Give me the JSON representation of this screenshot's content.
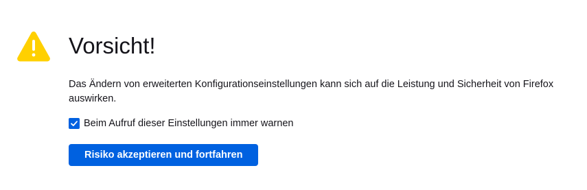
{
  "warning": {
    "icon": "warning-triangle-icon",
    "icon_color": "#ffd000",
    "title": "Vorsicht!",
    "description": "Das Ändern von erweiterten Konfigurationseinstellungen kann sich auf die Leistung und Sicherheit von Firefox auswirken.",
    "checkbox": {
      "label": "Beim Aufruf dieser Einstellungen immer warnen",
      "checked": true
    },
    "accept_button": {
      "label": "Risiko akzeptieren und fortfahren",
      "color": "#0061e0"
    }
  }
}
